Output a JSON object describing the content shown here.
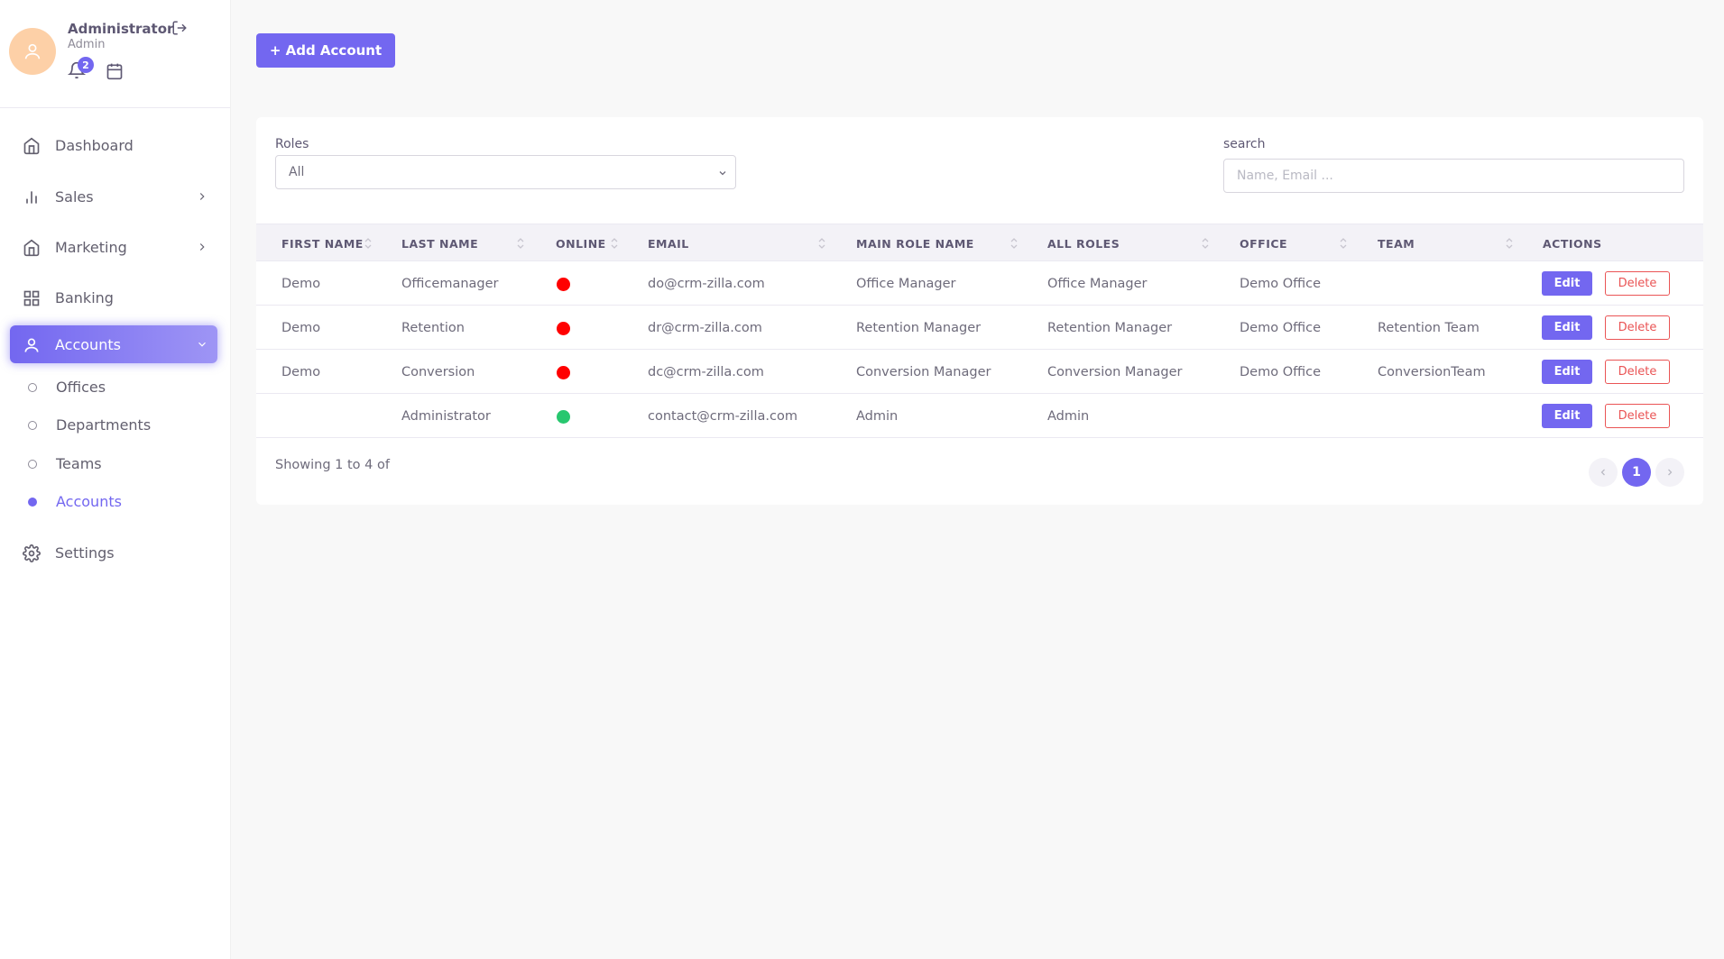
{
  "user": {
    "name": "Administrator",
    "role": "Admin",
    "notification_count": "2"
  },
  "sidebar": {
    "items": [
      {
        "label": "Dashboard"
      },
      {
        "label": "Sales"
      },
      {
        "label": "Marketing"
      },
      {
        "label": "Banking"
      },
      {
        "label": "Accounts"
      },
      {
        "label": "Settings"
      }
    ],
    "accounts_sub": [
      {
        "label": "Offices"
      },
      {
        "label": "Departments"
      },
      {
        "label": "Teams"
      },
      {
        "label": "Accounts"
      }
    ]
  },
  "toolbar": {
    "add_label": "+ Add Account"
  },
  "filters": {
    "roles_label": "Roles",
    "roles_value": "All",
    "search_label": "search",
    "search_placeholder": "Name, Email ..."
  },
  "table": {
    "headers": [
      "FIRST NAME",
      "LAST NAME",
      "ONLINE",
      "EMAIL",
      "MAIN ROLE NAME",
      "ALL ROLES",
      "OFFICE",
      "TEAM",
      "ACTIONS"
    ],
    "rows": [
      {
        "first": "Demo",
        "last": "Officemanager",
        "online": "offline",
        "email": "do@crm-zilla.com",
        "main_role": "Office Manager",
        "all_roles": "Office Manager",
        "office": "Demo Office",
        "team": ""
      },
      {
        "first": "Demo",
        "last": "Retention",
        "online": "offline",
        "email": "dr@crm-zilla.com",
        "main_role": "Retention Manager",
        "all_roles": "Retention Manager",
        "office": "Demo Office",
        "team": "Retention Team"
      },
      {
        "first": "Demo",
        "last": "Conversion",
        "online": "offline",
        "email": "dc@crm-zilla.com",
        "main_role": "Conversion Manager",
        "all_roles": "Conversion Manager",
        "office": "Demo Office",
        "team": "ConversionTeam"
      },
      {
        "first": "",
        "last": "Administrator",
        "online": "online",
        "email": "contact@crm-zilla.com",
        "main_role": "Admin",
        "all_roles": "Admin",
        "office": "",
        "team": ""
      }
    ],
    "edit_label": "Edit",
    "delete_label": "Delete"
  },
  "footer": {
    "showing": "Showing 1 to 4 of",
    "current_page": "1"
  },
  "colors": {
    "accent": "#7367f0",
    "offline": "#ff0000",
    "online": "#28c76f",
    "danger": "#ea5455"
  }
}
